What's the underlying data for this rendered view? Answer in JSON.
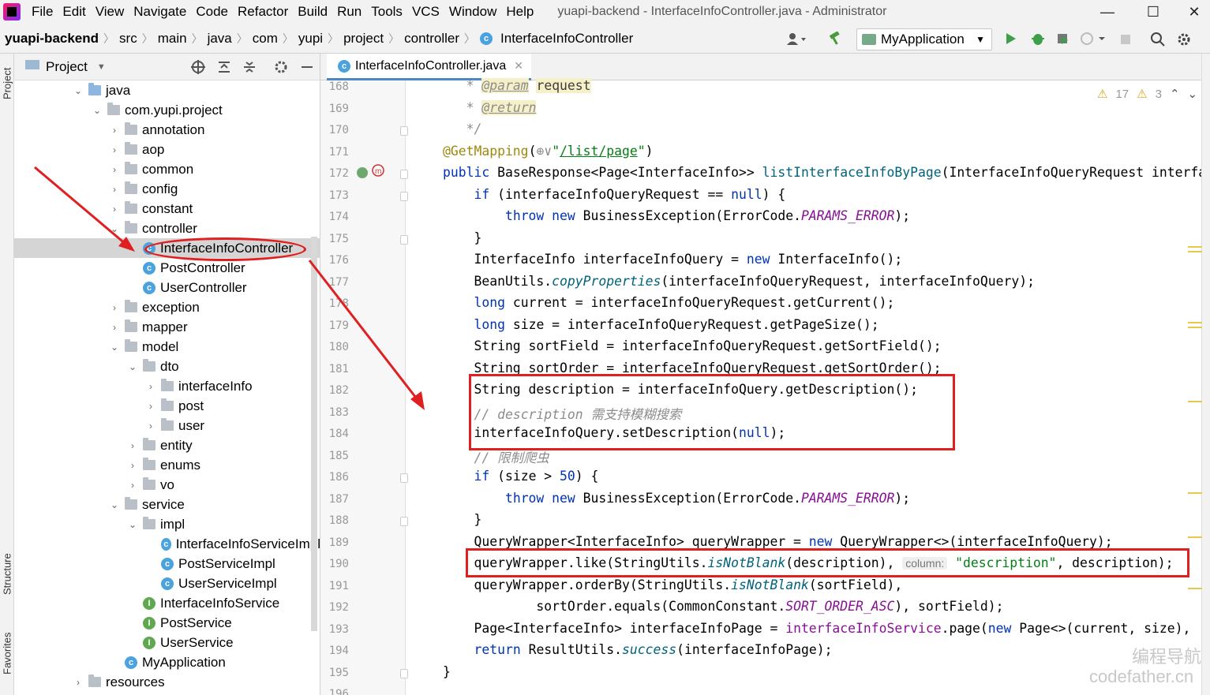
{
  "window": {
    "menu": [
      "File",
      "Edit",
      "View",
      "Navigate",
      "Code",
      "Refactor",
      "Build",
      "Run",
      "Tools",
      "VCS",
      "Window",
      "Help"
    ],
    "title": "yuapi-backend - InterfaceInfoController.java - Administrator",
    "minimize": "—",
    "maximize": "☐",
    "close": "✕"
  },
  "breadcrumb": [
    "yuapi-backend",
    "src",
    "main",
    "java",
    "com",
    "yupi",
    "project",
    "controller",
    "InterfaceInfoController"
  ],
  "toolbar": {
    "run_config": "MyApplication",
    "icons": [
      "user-icon",
      "hammer-icon",
      "run-icon",
      "debug-icon",
      "coverage-icon",
      "profile-icon",
      "stop-icon",
      "search-icon",
      "gear-icon"
    ]
  },
  "side_tabs": {
    "project": "Project",
    "structure": "Structure",
    "favorites": "Favorites"
  },
  "project_panel": {
    "title": "Project",
    "tree": [
      {
        "label": "java",
        "level": 1,
        "type": "folder-blue",
        "expanded": true
      },
      {
        "label": "com.yupi.project",
        "level": 2,
        "type": "folder",
        "expanded": true
      },
      {
        "label": "annotation",
        "level": 3,
        "type": "folder",
        "expanded": false
      },
      {
        "label": "aop",
        "level": 3,
        "type": "folder",
        "expanded": false
      },
      {
        "label": "common",
        "level": 3,
        "type": "folder",
        "expanded": false
      },
      {
        "label": "config",
        "level": 3,
        "type": "folder",
        "expanded": false
      },
      {
        "label": "constant",
        "level": 3,
        "type": "folder",
        "expanded": false
      },
      {
        "label": "controller",
        "level": 3,
        "type": "folder",
        "expanded": true
      },
      {
        "label": "InterfaceInfoController",
        "level": 4,
        "type": "class",
        "selected": true
      },
      {
        "label": "PostController",
        "level": 4,
        "type": "class"
      },
      {
        "label": "UserController",
        "level": 4,
        "type": "class"
      },
      {
        "label": "exception",
        "level": 3,
        "type": "folder",
        "expanded": false
      },
      {
        "label": "mapper",
        "level": 3,
        "type": "folder",
        "expanded": false
      },
      {
        "label": "model",
        "level": 3,
        "type": "folder",
        "expanded": true
      },
      {
        "label": "dto",
        "level": 4,
        "type": "folder",
        "expanded": true
      },
      {
        "label": "interfaceInfo",
        "level": 5,
        "type": "folder",
        "expanded": false
      },
      {
        "label": "post",
        "level": 5,
        "type": "folder",
        "expanded": false
      },
      {
        "label": "user",
        "level": 5,
        "type": "folder",
        "expanded": false
      },
      {
        "label": "entity",
        "level": 4,
        "type": "folder",
        "expanded": false
      },
      {
        "label": "enums",
        "level": 4,
        "type": "folder",
        "expanded": false
      },
      {
        "label": "vo",
        "level": 4,
        "type": "folder",
        "expanded": false
      },
      {
        "label": "service",
        "level": 3,
        "type": "folder",
        "expanded": true
      },
      {
        "label": "impl",
        "level": 4,
        "type": "folder",
        "expanded": true
      },
      {
        "label": "InterfaceInfoServiceImpl",
        "level": 5,
        "type": "class"
      },
      {
        "label": "PostServiceImpl",
        "level": 5,
        "type": "class"
      },
      {
        "label": "UserServiceImpl",
        "level": 5,
        "type": "class"
      },
      {
        "label": "InterfaceInfoService",
        "level": 4,
        "type": "interface"
      },
      {
        "label": "PostService",
        "level": 4,
        "type": "interface"
      },
      {
        "label": "UserService",
        "level": 4,
        "type": "interface"
      },
      {
        "label": "MyApplication",
        "level": 3,
        "type": "app"
      },
      {
        "label": "resources",
        "level": 1,
        "type": "folder",
        "expanded": false
      }
    ]
  },
  "editor": {
    "tab": "InterfaceInfoController.java",
    "inspections": {
      "warnings": "17",
      "weak_warnings": "3"
    },
    "lines": [
      {
        "n": "168",
        "html": "   <span class=\"cm\">* </span><span class=\"dtag\">@param</span> <span class=\"dparam\">request</span>"
      },
      {
        "n": "169",
        "html": "   <span class=\"cm\">* </span><span class=\"dtag\">@return</span>"
      },
      {
        "n": "170",
        "html": "   <span class=\"cm\">*/</span>"
      },
      {
        "n": "171",
        "html": "<span class=\"an\">@GetMapping</span>(<span class=\"cm\">⊕∨</span><span class=\"str\">\"<span class=\"url\">/list/page</span>\"</span>)"
      },
      {
        "n": "172",
        "html": "<span class=\"kw\">public</span> BaseResponse&lt;Page&lt;InterfaceInfo&gt;&gt; <span class=\"mt\">listInterfaceInfoByPage</span>(InterfaceInfoQueryRequest interfaceInfoQueryRequest) {"
      },
      {
        "n": "173",
        "html": "    <span class=\"kw\">if</span> (interfaceInfoQueryRequest == <span class=\"kw\">null</span>) {"
      },
      {
        "n": "174",
        "html": "        <span class=\"kw\">throw new</span> BusinessException(ErrorCode.<span class=\"st\">PARAMS_ERROR</span>);"
      },
      {
        "n": "175",
        "html": "    }"
      },
      {
        "n": "176",
        "html": "    InterfaceInfo interfaceInfoQuery = <span class=\"kw\">new</span> InterfaceInfo();"
      },
      {
        "n": "177",
        "html": "    BeanUtils.<span class=\"it\">copyProperties</span>(interfaceInfoQueryRequest, interfaceInfoQuery);"
      },
      {
        "n": "178",
        "html": "    <span class=\"kw\">long</span> current = interfaceInfoQueryRequest.getCurrent();"
      },
      {
        "n": "179",
        "html": "    <span class=\"kw\">long</span> size = interfaceInfoQueryRequest.getPageSize();"
      },
      {
        "n": "180",
        "html": "    String sortField = interfaceInfoQueryRequest.getSortField();"
      },
      {
        "n": "181",
        "html": "    String sortOrder = interfaceInfoQueryRequest.getSortOrder();"
      },
      {
        "n": "182",
        "html": "    String description = interfaceInfoQuery.getDescription();"
      },
      {
        "n": "183",
        "html": "    <span class=\"cm\">// description 需支持模糊搜索</span>"
      },
      {
        "n": "184",
        "html": "    interfaceInfoQuery.setDescription(<span class=\"kw\">null</span>);"
      },
      {
        "n": "185",
        "html": "    <span class=\"cm\">// 限制爬虫</span>"
      },
      {
        "n": "186",
        "html": "    <span class=\"kw\">if</span> (size &gt; <span class=\"kw\">50</span>) {"
      },
      {
        "n": "187",
        "html": "        <span class=\"kw\">throw new</span> BusinessException(ErrorCode.<span class=\"st\">PARAMS_ERROR</span>);"
      },
      {
        "n": "188",
        "html": "    }"
      },
      {
        "n": "189",
        "html": "    QueryWrapper&lt;InterfaceInfo&gt; queryWrapper = <span class=\"kw\">new</span> QueryWrapper&lt;&gt;(interfaceInfoQuery);"
      },
      {
        "n": "190",
        "html": "    queryWrapper.like(StringUtils.<span class=\"it\">isNotBlank</span>(description), <span class=\"hint\">column:</span> <span class=\"str\">\"description\"</span>, description);"
      },
      {
        "n": "191",
        "html": "    queryWrapper.orderBy(StringUtils.<span class=\"it\">isNotBlank</span>(sortField),"
      },
      {
        "n": "192",
        "html": "            sortOrder.equals(CommonConstant.<span class=\"st\">SORT_ORDER_ASC</span>), sortField);"
      },
      {
        "n": "193",
        "html": "    Page&lt;InterfaceInfo&gt; interfaceInfoPage = <span class=\"st\" style=\"font-style:normal\">interfaceInfoService</span>.page(<span class=\"kw\">new</span> Page&lt;&gt;(current, size),"
      },
      {
        "n": "194",
        "html": "    <span class=\"kw\">return</span> ResultUtils.<span class=\"it\">success</span>(interfaceInfoPage);"
      },
      {
        "n": "195",
        "html": "}"
      },
      {
        "n": "196",
        "html": ""
      }
    ]
  },
  "watermark": {
    "line1": "编程导航",
    "line2": "codefather.cn"
  },
  "colors": {
    "annotation_red": "#e02020",
    "selection": "#d5d5d5",
    "accent": "#4a88c7"
  }
}
